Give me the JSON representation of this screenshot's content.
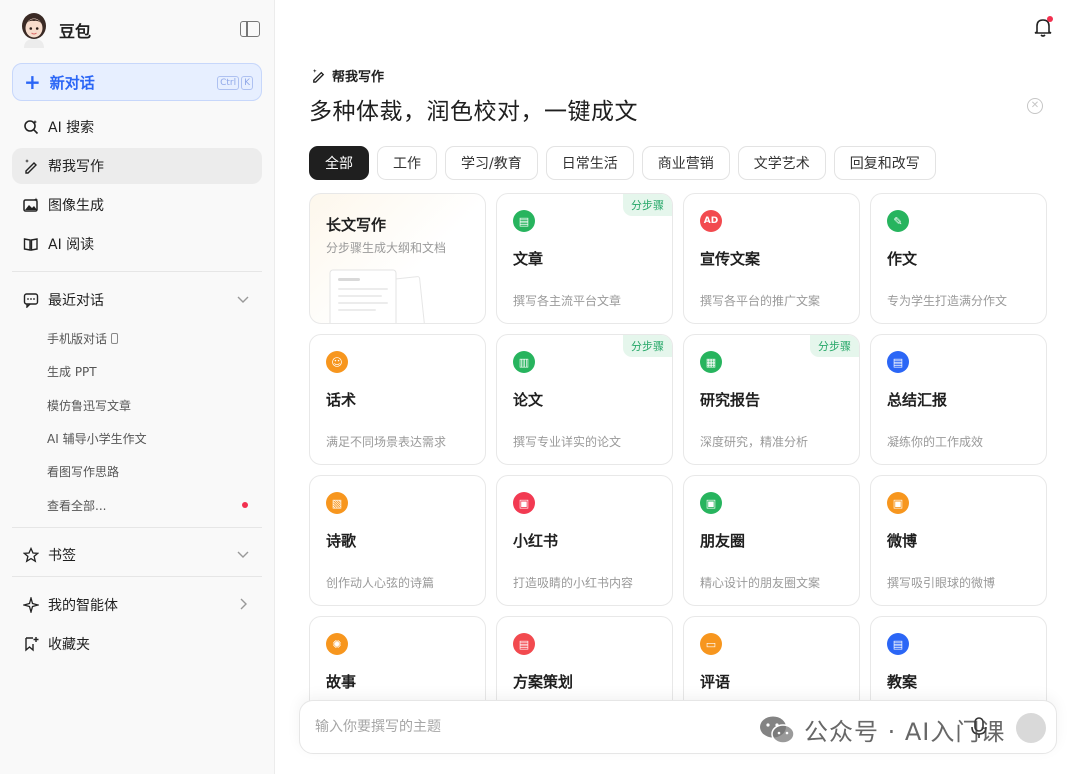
{
  "sidebar": {
    "brand_name": "豆包",
    "new_chat": {
      "label": "新对话",
      "shortcut": [
        "Ctrl",
        "K"
      ]
    },
    "nav": [
      {
        "label": "AI 搜索",
        "icon": "search-sparkle-icon"
      },
      {
        "label": "帮我写作",
        "icon": "pen-sparkle-icon",
        "active": true
      },
      {
        "label": "图像生成",
        "icon": "image-icon"
      },
      {
        "label": "AI 阅读",
        "icon": "book-icon"
      }
    ],
    "recent": {
      "label": "最近对话",
      "items": [
        "手机版对话",
        "生成 PPT",
        "模仿鲁迅写文章",
        "AI 辅导小学生作文",
        "看图写作思路"
      ],
      "view_all": "查看全部..."
    },
    "bookmarks": "书签",
    "agents": "我的智能体",
    "favorites": "收藏夹"
  },
  "main": {
    "section_label": "帮我写作",
    "headline": "多种体裁，润色校对，一键成文",
    "tabs": [
      "全部",
      "工作",
      "学习/教育",
      "日常生活",
      "商业营销",
      "文学艺术",
      "回复和改写"
    ],
    "active_tab": 0,
    "featured": {
      "title": "长文写作",
      "desc": "分步骤生成大纲和文档"
    },
    "cards": [
      {
        "title": "文章",
        "desc": "撰写各主流平台文章",
        "badge": "分步骤",
        "color": "#27b45e",
        "icon": "doc-icon",
        "glyph": "▤"
      },
      {
        "title": "宣传文案",
        "desc": "撰写各平台的推广文案",
        "badge": "",
        "color": "#f24a4f",
        "icon": "ad-icon",
        "glyph": "AD"
      },
      {
        "title": "作文",
        "desc": "专为学生打造满分作文",
        "badge": "",
        "color": "#27b45e",
        "icon": "pencil-icon",
        "glyph": "✎"
      },
      {
        "title": "话术",
        "desc": "满足不同场景表达需求",
        "badge": "",
        "color": "#f7961e",
        "icon": "speaker-icon",
        "glyph": "☺"
      },
      {
        "title": "论文",
        "desc": "撰写专业详实的论文",
        "badge": "分步骤",
        "color": "#27b45e",
        "icon": "bar-chart-icon",
        "glyph": "▥"
      },
      {
        "title": "研究报告",
        "desc": "深度研究，精准分析",
        "badge": "分步骤",
        "color": "#27b45e",
        "icon": "report-icon",
        "glyph": "▦"
      },
      {
        "title": "总结汇报",
        "desc": "凝练你的工作成效",
        "badge": "",
        "color": "#2b66f6",
        "icon": "summary-icon",
        "glyph": "▤"
      },
      {
        "title": "诗歌",
        "desc": "创作动人心弦的诗篇",
        "badge": "",
        "color": "#f7961e",
        "icon": "poem-icon",
        "glyph": "▧"
      },
      {
        "title": "小红书",
        "desc": "打造吸睛的小红书内容",
        "badge": "",
        "color": "#f23a52",
        "icon": "photo-icon",
        "glyph": "▣"
      },
      {
        "title": "朋友圈",
        "desc": "精心设计的朋友圈文案",
        "badge": "",
        "color": "#27b45e",
        "icon": "moments-icon",
        "glyph": "▣"
      },
      {
        "title": "微博",
        "desc": "撰写吸引眼球的微博",
        "badge": "",
        "color": "#f7961e",
        "icon": "weibo-icon",
        "glyph": "▣"
      },
      {
        "title": "故事",
        "desc": "",
        "badge": "",
        "color": "#f7961e",
        "icon": "bulb-icon",
        "glyph": "✺"
      },
      {
        "title": "方案策划",
        "desc": "",
        "badge": "",
        "color": "#f24a4f",
        "icon": "plan-icon",
        "glyph": "▤"
      },
      {
        "title": "评语",
        "desc": "",
        "badge": "",
        "color": "#f7961e",
        "icon": "comment-icon",
        "glyph": "▭"
      },
      {
        "title": "教案",
        "desc": "",
        "badge": "",
        "color": "#2b66f6",
        "icon": "lesson-icon",
        "glyph": "▤"
      }
    ],
    "input_placeholder": "输入你要撰写的主题"
  },
  "watermark": "公众号 · AI入门课"
}
